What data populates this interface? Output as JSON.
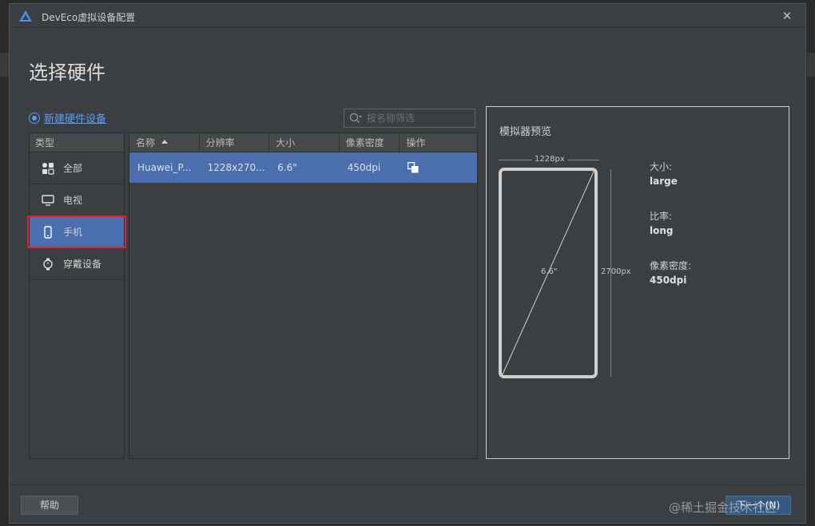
{
  "window": {
    "title": "DevEco虚拟设备配置",
    "close_glyph": "✕"
  },
  "page": {
    "title": "选择硬件"
  },
  "actions": {
    "new_device": "新建硬件设备"
  },
  "search": {
    "placeholder": "按名称筛选",
    "value": ""
  },
  "categories": {
    "header": "类型",
    "items": [
      {
        "label": "全部",
        "icon": "grid-icon",
        "selected": false
      },
      {
        "label": "电视",
        "icon": "tv-icon",
        "selected": false
      },
      {
        "label": "手机",
        "icon": "phone-icon",
        "selected": true
      },
      {
        "label": "穿戴设备",
        "icon": "watch-icon",
        "selected": false
      }
    ]
  },
  "table": {
    "columns": [
      "名称",
      "分辨率",
      "大小",
      "像素密度",
      "操作"
    ],
    "sort_column": "名称",
    "rows": [
      {
        "name": "Huawei_P...",
        "resolution": "1228x270...",
        "size": "6.6\"",
        "density": "450dpi",
        "action_icon": "copy-icon",
        "selected": true
      }
    ]
  },
  "preview": {
    "title": "模拟器预览",
    "width_label": "1228px",
    "height_label": "2700px",
    "diagonal_label": "6.6\"",
    "specs": [
      {
        "label": "大小:",
        "value": "large"
      },
      {
        "label": "比率:",
        "value": "long"
      },
      {
        "label": "像素密度:",
        "value": "450dpi"
      }
    ]
  },
  "footer": {
    "help": "帮助",
    "next": "下一个(N)"
  },
  "watermark": "@稀土掘金技术社区",
  "colors": {
    "accent": "#4b6eaf",
    "link": "#589df6",
    "highlight_border": "#e0262b",
    "background": "#3c3f41"
  }
}
